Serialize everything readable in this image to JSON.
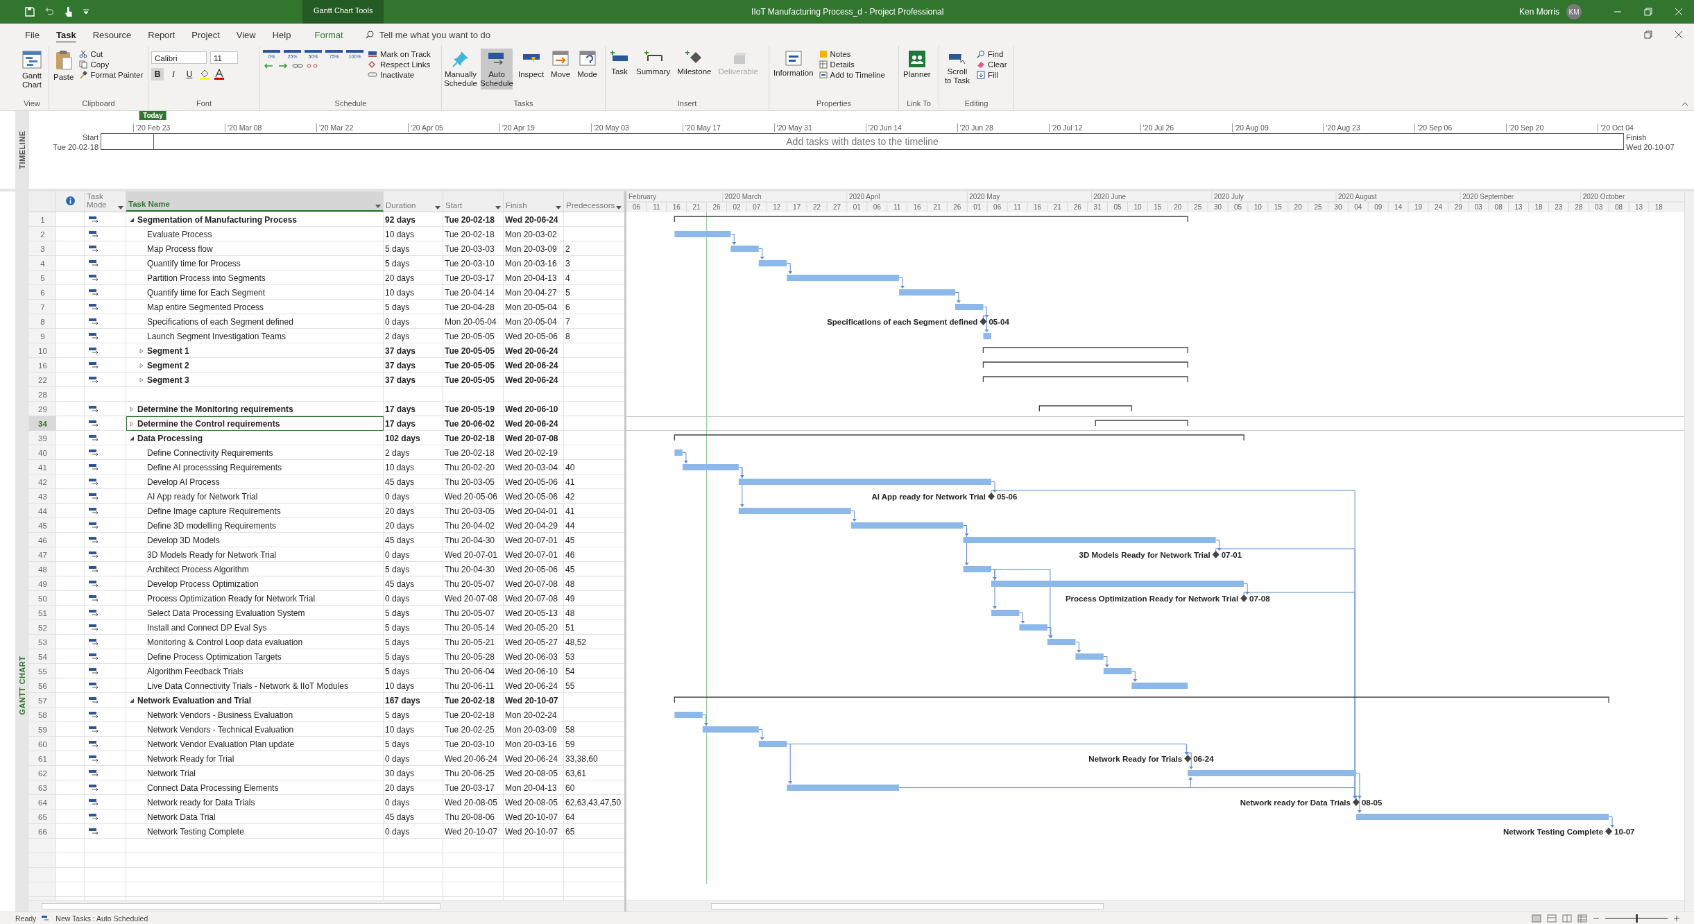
{
  "title_bar": {
    "context_label": "Gantt Chart Tools",
    "title": "IIoT Manufacturing Process_d  -  Project Professional",
    "user": "Ken Morris",
    "avatar": "KM"
  },
  "tabs": [
    {
      "label": "File",
      "selected": false,
      "kind": "plain"
    },
    {
      "label": "Task",
      "selected": true,
      "kind": "plain"
    },
    {
      "label": "Resource",
      "selected": false,
      "kind": "plain"
    },
    {
      "label": "Report",
      "selected": false,
      "kind": "plain"
    },
    {
      "label": "Project",
      "selected": false,
      "kind": "plain"
    },
    {
      "label": "View",
      "selected": false,
      "kind": "plain"
    },
    {
      "label": "Help",
      "selected": false,
      "kind": "plain"
    },
    {
      "label": "Format",
      "selected": false,
      "kind": "contextual"
    }
  ],
  "tell_me": {
    "placeholder": "Tell me what you want to do"
  },
  "ribbon": {
    "view": {
      "label": "View",
      "gantt_chart": "Gantt Chart"
    },
    "clipboard": {
      "label": "Clipboard",
      "paste": "Paste",
      "cut": "Cut",
      "copy": "Copy",
      "format_painter": "Format Painter"
    },
    "font": {
      "label": "Font",
      "family": "Calibri",
      "size": "11",
      "bold": "B",
      "italic": "I",
      "underline": "U"
    },
    "schedule": {
      "label": "Schedule",
      "percent_buttons": [
        "0%",
        "25%",
        "50%",
        "75%",
        "100%"
      ],
      "mark_on_track": "Mark on Track",
      "respect_links": "Respect Links",
      "inactivate": "Inactivate"
    },
    "tasks": {
      "label": "Tasks",
      "manually_schedule": {
        "label": "Manually Schedule",
        "selected": false
      },
      "auto_schedule": {
        "label": "Auto Schedule",
        "selected": true
      },
      "inspect": "Inspect",
      "move": "Move",
      "mode": "Mode"
    },
    "insert": {
      "label": "Insert",
      "task": "Task",
      "summary": "Summary",
      "milestone": "Milestone",
      "deliverable": {
        "label": "Deliverable",
        "disabled": true
      }
    },
    "properties": {
      "label": "Properties",
      "information": "Information",
      "notes": "Notes",
      "details": "Details",
      "add_to_timeline": "Add to Timeline"
    },
    "link_to": {
      "label": "Link To",
      "planner": "Planner"
    },
    "editing": {
      "label": "Editing",
      "scroll_to_task": "Scroll to Task",
      "find": "Find",
      "clear": "Clear",
      "fill": "Fill"
    }
  },
  "timeline": {
    "label": "TIMELINE",
    "today": "Today",
    "ticks": [
      "'20 Feb 23",
      "'20 Mar 08",
      "'20 Mar 22",
      "'20 Apr 05",
      "'20 Apr 19",
      "'20 May 03",
      "'20 May 17",
      "'20 May 31",
      "'20 Jun 14",
      "'20 Jun 28",
      "'20 Jul 12",
      "'20 Jul 26",
      "'20 Aug 09",
      "'20 Aug 23",
      "'20 Sep 06",
      "'20 Sep 20",
      "'20 Oct 04"
    ],
    "start_label": "Start",
    "start_date": "Tue 20-02-18",
    "placeholder_text": "Add tasks with dates to the timeline",
    "finish_label": "Finish",
    "finish_date": "Wed 20-10-07"
  },
  "gantt": {
    "side_label": "GANTT CHART",
    "columns": {
      "task_mode": "Task Mode",
      "task_name": "Task Name",
      "duration": "Duration",
      "start": "Start",
      "finish": "Finish",
      "predecessors": "Predecessors"
    },
    "months": [
      "February",
      "2020 March",
      "2020 April",
      "2020 May",
      "2020 June",
      "2020 July",
      "2020 August",
      "2020 September",
      "2020 October"
    ],
    "day_ticks": [
      "06",
      "11",
      "16",
      "21",
      "26",
      "02",
      "07",
      "12",
      "17",
      "22",
      "27",
      "01",
      "06",
      "11",
      "16",
      "21",
      "26",
      "01",
      "06",
      "11",
      "16",
      "21",
      "26",
      "31",
      "05",
      "10",
      "15",
      "20",
      "25",
      "30",
      "05",
      "10",
      "15",
      "20",
      "25",
      "30",
      "04",
      "09",
      "14",
      "19",
      "24",
      "29",
      "03",
      "08",
      "13",
      "18",
      "23",
      "28",
      "03",
      "08",
      "13",
      "18"
    ],
    "rows": [
      {
        "id": "1",
        "kind": "summary",
        "expanded": true,
        "selected": false,
        "name": "Segmentation of Manufacturing Process",
        "duration": "92 days",
        "start": "Tue 20-02-18",
        "finish": "Wed 20-06-24",
        "children": [
          {
            "id": "2",
            "kind": "task",
            "selected": false,
            "name": "Evaluate Process",
            "duration": "10 days",
            "start": "Tue 20-02-18",
            "finish": "Mon 20-03-02"
          },
          {
            "id": "3",
            "kind": "task",
            "selected": false,
            "name": "Map Process flow",
            "duration": "5 days",
            "start": "Tue 20-03-03",
            "finish": "Mon 20-03-09",
            "predecessors": "2"
          },
          {
            "id": "4",
            "kind": "task",
            "selected": false,
            "name": "Quantify time for Process",
            "duration": "5 days",
            "start": "Tue 20-03-10",
            "finish": "Mon 20-03-16",
            "predecessors": "3"
          },
          {
            "id": "5",
            "kind": "task",
            "selected": false,
            "name": "Partition Process into Segments",
            "duration": "20 days",
            "start": "Tue 20-03-17",
            "finish": "Mon 20-04-13",
            "predecessors": "4"
          },
          {
            "id": "6",
            "kind": "task",
            "selected": false,
            "name": "Quantify time for Each Segment",
            "duration": "10 days",
            "start": "Tue 20-04-14",
            "finish": "Mon 20-04-27",
            "predecessors": "5"
          },
          {
            "id": "7",
            "kind": "task",
            "selected": false,
            "name": "Map entire Segmented Process",
            "duration": "5 days",
            "start": "Tue 20-04-28",
            "finish": "Mon 20-05-04",
            "predecessors": "6"
          },
          {
            "id": "8",
            "kind": "milestone",
            "selected": false,
            "name": "Specifications of each Segment defined",
            "duration": "0 days",
            "start": "Mon 20-05-04",
            "finish": "Mon 20-05-04",
            "predecessors": "7",
            "chart_label": "Specifications of each Segment defined",
            "chart_date": "05-04"
          },
          {
            "id": "9",
            "kind": "task",
            "selected": false,
            "name": "Launch Segment Investigation Teams",
            "duration": "2 days",
            "start": "Tue 20-05-05",
            "finish": "Wed 20-05-06",
            "predecessors": "8"
          },
          {
            "id": "10",
            "kind": "summary",
            "expanded": false,
            "selected": false,
            "name": "Segment 1",
            "duration": "37 days",
            "start": "Tue 20-05-05",
            "finish": "Wed 20-06-24"
          },
          {
            "id": "16",
            "kind": "summary",
            "expanded": false,
            "selected": false,
            "name": "Segment 2",
            "duration": "37 days",
            "start": "Tue 20-05-05",
            "finish": "Wed 20-06-24"
          },
          {
            "id": "22",
            "kind": "summary",
            "expanded": false,
            "selected": false,
            "name": "Segment 3",
            "duration": "37 days",
            "start": "Tue 20-05-05",
            "finish": "Wed 20-06-24"
          }
        ]
      },
      {
        "id": "28",
        "kind": "blank",
        "selected": false
      },
      {
        "id": "29",
        "kind": "summary",
        "expanded": false,
        "selected": false,
        "name": "Determine the Monitoring requirements",
        "duration": "17 days",
        "start": "Tue 20-05-19",
        "finish": "Wed 20-06-10"
      },
      {
        "id": "34",
        "kind": "summary",
        "expanded": false,
        "selected": true,
        "name": "Determine the Control requirements",
        "duration": "17 days",
        "start": "Tue 20-06-02",
        "finish": "Wed 20-06-24"
      },
      {
        "id": "39",
        "kind": "summary",
        "expanded": true,
        "selected": false,
        "name": "Data Processing",
        "duration": "102 days",
        "start": "Tue 20-02-18",
        "finish": "Wed 20-07-08",
        "children": [
          {
            "id": "40",
            "kind": "task",
            "selected": false,
            "name": "Define Connectivity Requirements",
            "duration": "2 days",
            "start": "Tue 20-02-18",
            "finish": "Wed 20-02-19"
          },
          {
            "id": "41",
            "kind": "task",
            "selected": false,
            "name": "Define AI processsing Requirements",
            "duration": "10 days",
            "start": "Thu 20-02-20",
            "finish": "Wed 20-03-04",
            "predecessors": "40"
          },
          {
            "id": "42",
            "kind": "task",
            "selected": false,
            "name": "Develop AI Process",
            "duration": "45 days",
            "start": "Thu 20-03-05",
            "finish": "Wed 20-05-06",
            "predecessors": "41"
          },
          {
            "id": "43",
            "kind": "milestone",
            "selected": false,
            "name": "AI App ready for Network Trial",
            "duration": "0 days",
            "start": "Wed 20-05-06",
            "finish": "Wed 20-05-06",
            "predecessors": "42",
            "chart_label": "AI App ready for Network Trial",
            "chart_date": "05-06"
          },
          {
            "id": "44",
            "kind": "task",
            "selected": false,
            "name": "Define Image capture Requirements",
            "duration": "20 days",
            "start": "Thu 20-03-05",
            "finish": "Wed 20-04-01",
            "predecessors": "41"
          },
          {
            "id": "45",
            "kind": "task",
            "selected": false,
            "name": "Define 3D modelling Requirements",
            "duration": "20 days",
            "start": "Thu 20-04-02",
            "finish": "Wed 20-04-29",
            "predecessors": "44"
          },
          {
            "id": "46",
            "kind": "task",
            "selected": false,
            "name": "Develop 3D Models",
            "duration": "45 days",
            "start": "Thu 20-04-30",
            "finish": "Wed 20-07-01",
            "predecessors": "45"
          },
          {
            "id": "47",
            "kind": "milestone",
            "selected": false,
            "name": "3D Models Ready for Network Trial",
            "duration": "0 days",
            "start": "Wed 20-07-01",
            "finish": "Wed 20-07-01",
            "predecessors": "46",
            "chart_label": "3D Models Ready for Network Trial",
            "chart_date": "07-01"
          },
          {
            "id": "48",
            "kind": "task",
            "selected": false,
            "name": "Architect Process Algorithm",
            "duration": "5 days",
            "start": "Thu 20-04-30",
            "finish": "Wed 20-05-06",
            "predecessors": "45"
          },
          {
            "id": "49",
            "kind": "task",
            "selected": false,
            "name": "Develop Process Optimization",
            "duration": "45 days",
            "start": "Thu 20-05-07",
            "finish": "Wed 20-07-08",
            "predecessors": "48"
          },
          {
            "id": "50",
            "kind": "milestone",
            "selected": false,
            "name": "Process Optimization Ready for Network Trial",
            "duration": "0 days",
            "start": "Wed 20-07-08",
            "finish": "Wed 20-07-08",
            "predecessors": "49",
            "chart_label": "Process Optimization Ready for Network Trial",
            "chart_date": "07-08"
          },
          {
            "id": "51",
            "kind": "task",
            "selected": false,
            "name": "Select Data Processing Evaluation System",
            "duration": "5 days",
            "start": "Thu 20-05-07",
            "finish": "Wed 20-05-13",
            "predecessors": "48"
          },
          {
            "id": "52",
            "kind": "task",
            "selected": false,
            "name": "Install and Connect DP Eval Sys",
            "duration": "5 days",
            "start": "Thu 20-05-14",
            "finish": "Wed 20-05-20",
            "predecessors": "51"
          },
          {
            "id": "53",
            "kind": "task",
            "selected": false,
            "name": "Monitoring & Control Loop data evaluation",
            "duration": "5 days",
            "start": "Thu 20-05-21",
            "finish": "Wed 20-05-27",
            "predecessors": "48,52"
          },
          {
            "id": "54",
            "kind": "task",
            "selected": false,
            "name": "Define Process Optimization Targets",
            "duration": "5 days",
            "start": "Thu 20-05-28",
            "finish": "Wed 20-06-03",
            "predecessors": "53"
          },
          {
            "id": "55",
            "kind": "task",
            "selected": false,
            "name": "Algorithm Feedback Trials",
            "duration": "5 days",
            "start": "Thu 20-06-04",
            "finish": "Wed 20-06-10",
            "predecessors": "54"
          },
          {
            "id": "56",
            "kind": "task",
            "selected": false,
            "name": "Live Data Connectivity Trials - Network & IIoT Modules",
            "duration": "10 days",
            "start": "Thu 20-06-11",
            "finish": "Wed 20-06-24",
            "predecessors": "55"
          }
        ]
      },
      {
        "id": "57",
        "kind": "summary",
        "expanded": true,
        "selected": false,
        "name": "Network Evaluation and Trial",
        "duration": "167 days",
        "start": "Tue 20-02-18",
        "finish": "Wed 20-10-07",
        "children": [
          {
            "id": "58",
            "kind": "task",
            "selected": false,
            "name": "Network Vendors - Business Evaluation",
            "duration": "5 days",
            "start": "Tue 20-02-18",
            "finish": "Mon 20-02-24"
          },
          {
            "id": "59",
            "kind": "task",
            "selected": false,
            "name": "Network Vendors - Technical Evaluation",
            "duration": "10 days",
            "start": "Tue 20-02-25",
            "finish": "Mon 20-03-09",
            "predecessors": "58"
          },
          {
            "id": "60",
            "kind": "task",
            "selected": false,
            "name": "Network Vendor Evaluation Plan update",
            "duration": "5 days",
            "start": "Tue 20-03-10",
            "finish": "Mon 20-03-16",
            "predecessors": "59"
          },
          {
            "id": "61",
            "kind": "milestone",
            "selected": false,
            "name": "Network Ready for Trial",
            "duration": "0 days",
            "start": "Wed 20-06-24",
            "finish": "Wed 20-06-24",
            "predecessors": "33,38,60",
            "chart_label": "Network Ready for Trials",
            "chart_date": "06-24"
          },
          {
            "id": "62",
            "kind": "task",
            "selected": false,
            "name": "Network Trial",
            "duration": "30 days",
            "start": "Thu 20-06-25",
            "finish": "Wed 20-08-05",
            "predecessors": "63,61"
          },
          {
            "id": "63",
            "kind": "task",
            "selected": false,
            "name": "Connect Data Processing Elements",
            "duration": "20 days",
            "start": "Tue 20-03-17",
            "finish": "Mon 20-04-13",
            "predecessors": "60"
          },
          {
            "id": "64",
            "kind": "milestone",
            "selected": false,
            "name": "Network ready for Data Trials",
            "duration": "0 days",
            "start": "Wed 20-08-05",
            "finish": "Wed 20-08-05",
            "predecessors": "62,63,43,47,50",
            "chart_label": "Network ready for Data Trials",
            "chart_date": "08-05"
          },
          {
            "id": "65",
            "kind": "task",
            "selected": false,
            "name": "Network Data Trial",
            "duration": "45 days",
            "start": "Thu 20-08-06",
            "finish": "Wed 20-10-07",
            "predecessors": "64"
          },
          {
            "id": "66",
            "kind": "milestone",
            "selected": false,
            "name": "Network Testing Complete",
            "duration": "0 days",
            "start": "Wed 20-10-07",
            "finish": "Wed 20-10-07",
            "predecessors": "65",
            "chart_label": "Network Testing Complete",
            "chart_date": "10-07"
          }
        ]
      }
    ]
  },
  "status_bar": {
    "ready": "Ready",
    "new_tasks": "New Tasks : Auto Scheduled",
    "zoom": {
      "level": 0.5
    }
  }
}
